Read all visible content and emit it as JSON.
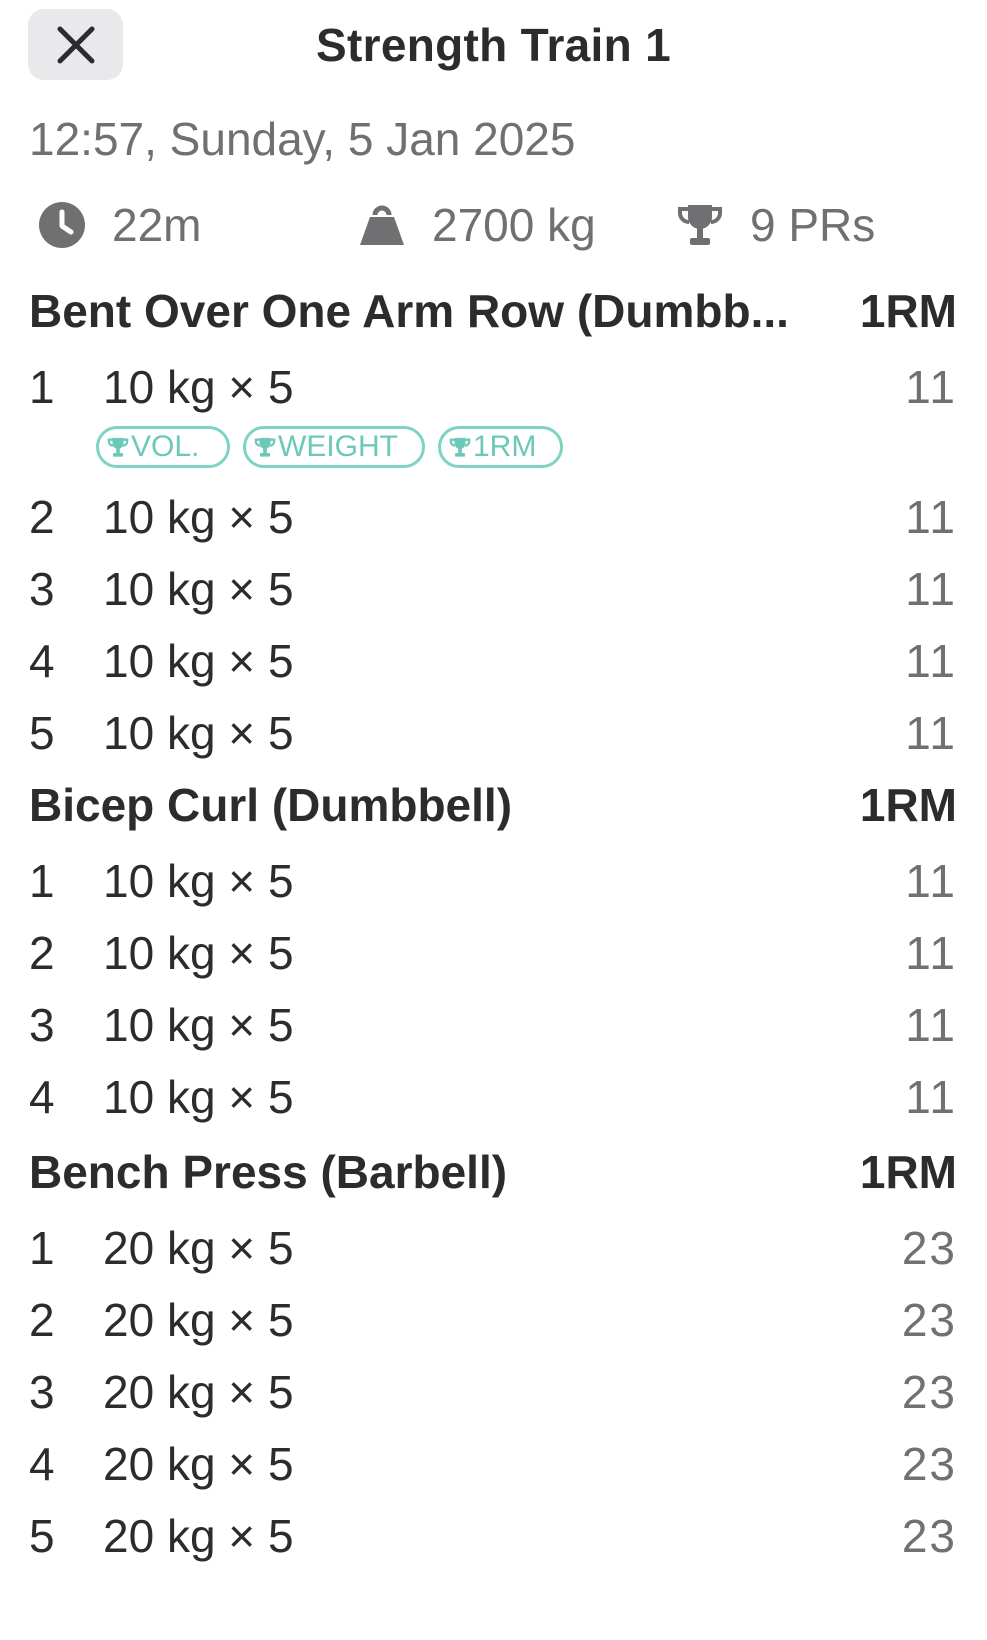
{
  "header": {
    "close_icon": "close-icon",
    "title": "Strength Train 1"
  },
  "date": "12:57, Sunday, 5 Jan 2025",
  "stats": {
    "duration": {
      "icon": "clock-icon",
      "value": "22m"
    },
    "volume": {
      "icon": "weight-icon",
      "value": "2700 kg"
    },
    "prs": {
      "icon": "trophy-icon",
      "value": "9 PRs"
    }
  },
  "colors": {
    "text_primary": "#2c2c2e",
    "text_secondary": "#707072",
    "badge_accent": "#7fd3c5",
    "close_button_bg": "#e9e9eb"
  },
  "exercises": [
    {
      "name": "Bent Over One Arm Row (Dumbb...",
      "column_label": "1RM",
      "sets": [
        {
          "num": "1",
          "weight_reps": "10 kg × 5",
          "one_rm": "11",
          "badges": [
            "VOL.",
            "WEIGHT",
            "1RM"
          ]
        },
        {
          "num": "2",
          "weight_reps": "10 kg × 5",
          "one_rm": "11"
        },
        {
          "num": "3",
          "weight_reps": "10 kg × 5",
          "one_rm": "11"
        },
        {
          "num": "4",
          "weight_reps": "10 kg × 5",
          "one_rm": "11"
        },
        {
          "num": "5",
          "weight_reps": "10 kg × 5",
          "one_rm": "11"
        }
      ]
    },
    {
      "name": "Bicep Curl (Dumbbell)",
      "column_label": "1RM",
      "sets": [
        {
          "num": "1",
          "weight_reps": "10 kg × 5",
          "one_rm": "11"
        },
        {
          "num": "2",
          "weight_reps": "10 kg × 5",
          "one_rm": "11"
        },
        {
          "num": "3",
          "weight_reps": "10 kg × 5",
          "one_rm": "11"
        },
        {
          "num": "4",
          "weight_reps": "10 kg × 5",
          "one_rm": "11"
        }
      ]
    },
    {
      "name": "Bench Press (Barbell)",
      "column_label": "1RM",
      "sets": [
        {
          "num": "1",
          "weight_reps": "20 kg × 5",
          "one_rm": "23"
        },
        {
          "num": "2",
          "weight_reps": "20 kg × 5",
          "one_rm": "23"
        },
        {
          "num": "3",
          "weight_reps": "20 kg × 5",
          "one_rm": "23"
        },
        {
          "num": "4",
          "weight_reps": "20 kg × 5",
          "one_rm": "23"
        },
        {
          "num": "5",
          "weight_reps": "20 kg × 5",
          "one_rm": "23"
        }
      ]
    }
  ]
}
